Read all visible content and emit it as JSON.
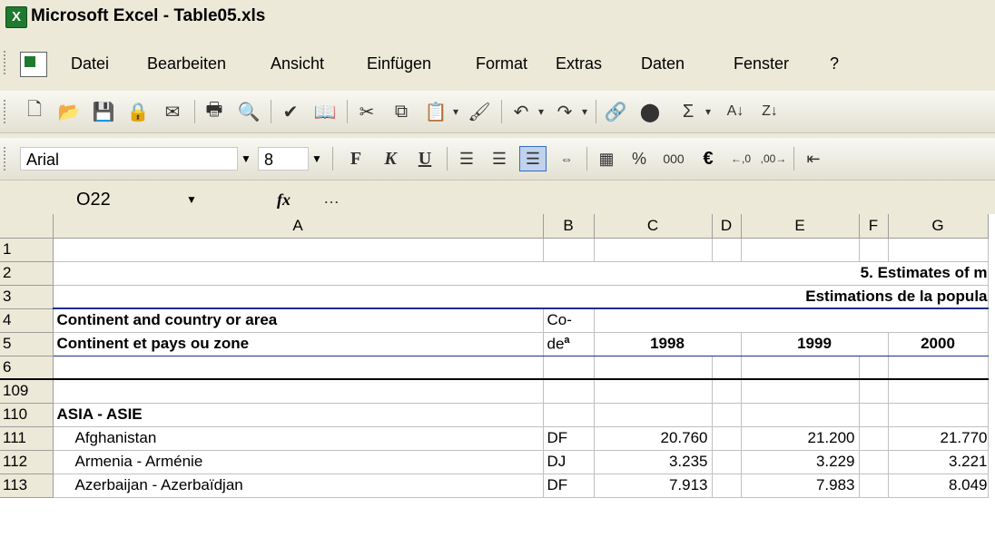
{
  "window": {
    "title": "Microsoft Excel - Table05.xls"
  },
  "menu": [
    "Datei",
    "Bearbeiten",
    "Ansicht",
    "Einfügen",
    "Format",
    "Extras",
    "Daten",
    "Fenster",
    "?"
  ],
  "format_toolbar": {
    "font": "Arial",
    "size": "8",
    "currency_symbol": "€",
    "thousands": "000",
    "percent": "%"
  },
  "formula_bar": {
    "name_box": "O22",
    "fx_label": "fx",
    "formula": "…"
  },
  "columns": [
    "A",
    "B",
    "C",
    "D",
    "E",
    "F",
    "G"
  ],
  "rows": {
    "r1": "1",
    "r2": {
      "num": "2",
      "title": "5. Estimates of m"
    },
    "r3": {
      "num": "3",
      "title": "Estimations de la popula"
    },
    "r4": {
      "num": "4",
      "label": "Continent and country or area",
      "code": "Co-"
    },
    "r5": {
      "num": "5",
      "label": "Continent et pays ou zone",
      "code": "de",
      "code_sup": "a",
      "y1": "1998",
      "y2": "1999",
      "y3": "2000"
    },
    "r6": "6",
    "r109": "109",
    "r110": {
      "num": "110",
      "label": "ASIA - ASIE"
    },
    "r111": {
      "num": "111",
      "label": "Afghanistan",
      "code": "DF",
      "v1": "20.760",
      "v2": "21.200",
      "v3": "21.770"
    },
    "r112": {
      "num": "112",
      "label": "Armenia - Arménie",
      "code": "DJ",
      "v1": "3.235",
      "v2": "3.229",
      "v3": "3.221"
    },
    "r113": {
      "num": "113",
      "label": "Azerbaijan - Azerbaïdjan",
      "code": "DF",
      "v1": "7.913",
      "v2": "7.983",
      "v3": "8.049"
    }
  }
}
